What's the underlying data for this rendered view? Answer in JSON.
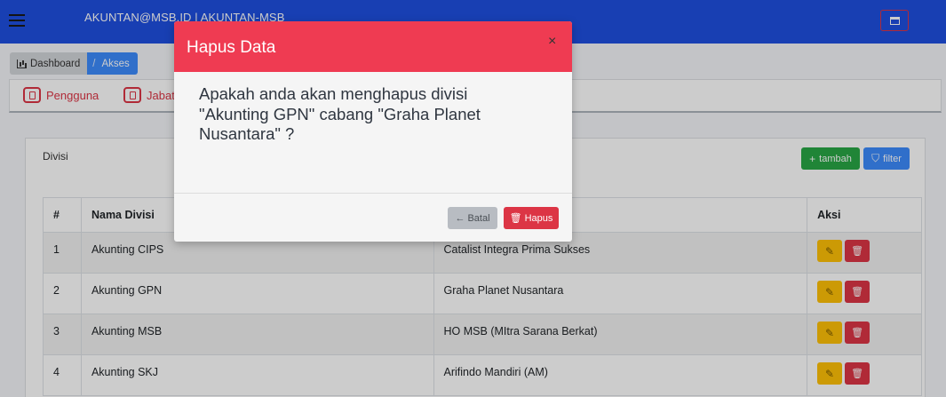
{
  "navbar": {
    "title": "AKUNTAN@MSB.ID | AKUNTAN-MSB",
    "menu_icon": "hamburger-icon",
    "window_icon": "window-icon"
  },
  "breadcrumb": {
    "items": [
      {
        "label": "Dashboard",
        "icon": "chart-icon"
      },
      {
        "label": "Akses",
        "separator": "/"
      }
    ]
  },
  "tabs": [
    {
      "label": "Pengguna",
      "icon": "users-icon"
    },
    {
      "label": "Jabat",
      "icon": "bookmark-icon"
    }
  ],
  "card": {
    "title": "Divisi",
    "add_button": {
      "icon": "+",
      "label": "tambah"
    },
    "filter_button": {
      "icon": "⛉",
      "label": "filter"
    }
  },
  "table": {
    "headers": [
      "#",
      "Nama Divisi",
      "",
      "Aksi"
    ],
    "rows": [
      {
        "no": "1",
        "nama": "Akunting CIPS",
        "cabang": "Catalist Integra Prima Sukses"
      },
      {
        "no": "2",
        "nama": "Akunting GPN",
        "cabang": "Graha Planet Nusantara"
      },
      {
        "no": "3",
        "nama": "Akunting MSB",
        "cabang": "HO MSB (MItra Sarana Berkat)"
      },
      {
        "no": "4",
        "nama": "Akunting SKJ",
        "cabang": "Arifindo Mandiri (AM)"
      }
    ]
  },
  "modal": {
    "title": "Hapus Data",
    "close": "×",
    "message": "Apakah anda akan menghapus divisi \"Akunting GPN\" cabang \"Graha Planet Nusantara\" ?",
    "cancel_icon": "←",
    "cancel_label": "Batal",
    "delete_icon": "🗑",
    "delete_label": "Hapus"
  },
  "colors": {
    "navbar": "#1f4fe0",
    "modal_header": "#ef3b52",
    "danger": "#dc3545",
    "success": "#28a745",
    "primary": "#3d8bfd",
    "warning": "#ffc107"
  }
}
